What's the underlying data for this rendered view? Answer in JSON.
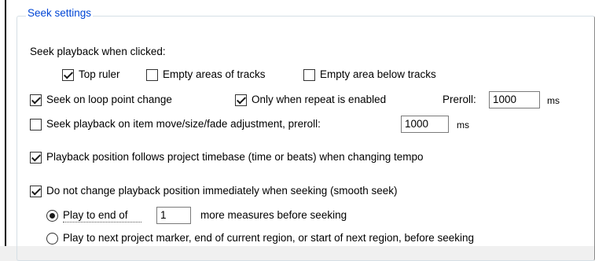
{
  "group": {
    "title": "Seek settings"
  },
  "seek_when_clicked": {
    "label": "Seek playback when clicked:",
    "top_ruler": {
      "label": "Top ruler",
      "checked": true
    },
    "empty_tracks": {
      "label": "Empty areas of tracks",
      "checked": false
    },
    "empty_below": {
      "label": "Empty area below tracks",
      "checked": false
    }
  },
  "loop_point": {
    "label": "Seek on loop point change",
    "checked": true
  },
  "only_repeat": {
    "label": "Only when repeat is enabled",
    "checked": true
  },
  "preroll": {
    "label": "Preroll:",
    "value": "1000",
    "unit": "ms"
  },
  "item_move": {
    "label": "Seek playback on item move/size/fade adjustment, preroll:",
    "checked": false,
    "value": "1000",
    "unit": "ms"
  },
  "timebase": {
    "label": "Playback position follows project timebase (time or beats) when changing tempo",
    "checked": true
  },
  "smooth_seek": {
    "label": "Do not change playback position immediately when seeking (smooth seek)",
    "checked": true,
    "play_to_end": {
      "label": "Play to end of",
      "value": "1",
      "suffix": "more measures before seeking",
      "selected": true
    },
    "play_to_marker": {
      "label": "Play to next project marker, end of current region, or start of next region, before seeking",
      "selected": false
    }
  }
}
